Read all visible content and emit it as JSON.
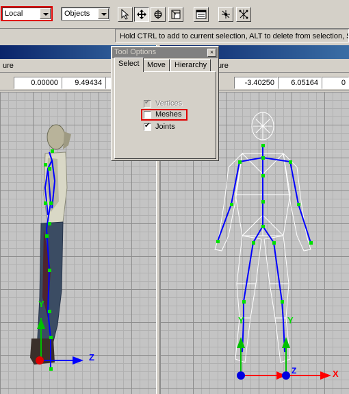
{
  "toolbar": {
    "coord_mode": "Local",
    "selection_mode": "Objects",
    "tool_icons": [
      "select-arrow-icon",
      "move-icon",
      "rotate-icon",
      "scale-icon",
      "window-icon",
      "joint-icon",
      "joints-icon"
    ]
  },
  "status_bar": {
    "message": "Hold CTRL to add to current selection, ALT to delete from selection, SHI"
  },
  "viewport_left": {
    "menu_label": "ure",
    "coord_x": "0.00000",
    "coord_y": "9.49434",
    "axis_up": "Y",
    "axis_right": "Z"
  },
  "viewport_right": {
    "menu_label": "ure",
    "coord_x": "-3.40250",
    "coord_y": "6.05164",
    "coord_z": "0",
    "axis_up": "Y",
    "axis_right": "X",
    "axis_right2": "X",
    "axis_z": "Z"
  },
  "tool_options": {
    "title": "Tool Options",
    "close_label": "×",
    "tabs": [
      {
        "label": "Select",
        "active": true
      },
      {
        "label": "Move",
        "active": false
      },
      {
        "label": "Hierarchy",
        "active": false
      }
    ],
    "options": [
      {
        "label": "Vertices",
        "checked": true,
        "disabled": true
      },
      {
        "label": "Meshes",
        "checked": false,
        "disabled": false
      },
      {
        "label": "Joints",
        "checked": true,
        "disabled": false
      }
    ]
  },
  "colors": {
    "highlight": "#e00000",
    "bone": "#0000ff",
    "joint": "#00e000",
    "axis_x": "#ff0000",
    "title_bar": "#0a246a"
  }
}
